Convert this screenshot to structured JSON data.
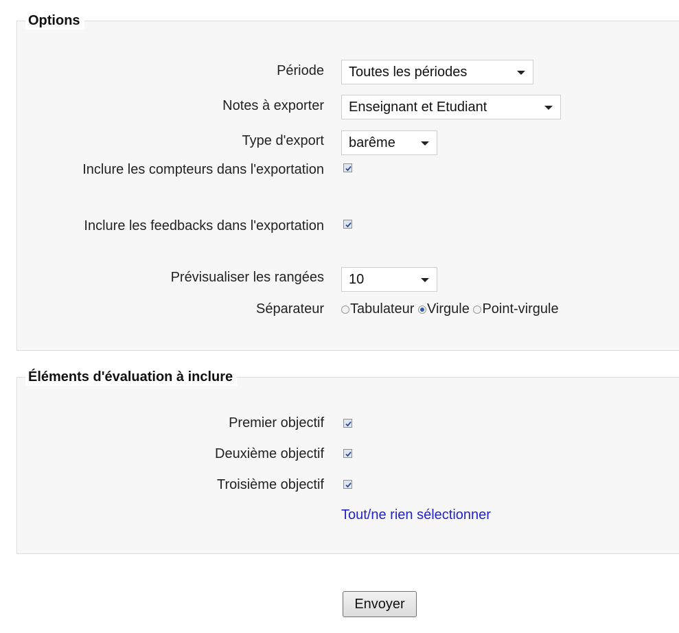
{
  "options": {
    "legend": "Options",
    "periode": {
      "label": "Période",
      "value": "Toutes les périodes"
    },
    "notes": {
      "label": "Notes à exporter",
      "value": "Enseignant et Etudiant"
    },
    "type": {
      "label": "Type d'export",
      "value": "barême"
    },
    "compteurs": {
      "label": "Inclure les compteurs dans l'exportation",
      "checked": true
    },
    "feedbacks": {
      "label": "Inclure les feedbacks dans l'exportation",
      "checked": true
    },
    "rangees": {
      "label": "Prévisualiser les rangées",
      "value": "10"
    },
    "separateur": {
      "label": "Séparateur",
      "options": [
        "Tabulateur",
        "Virgule",
        "Point-virgule"
      ],
      "selected": "Virgule"
    }
  },
  "eval": {
    "legend": "Éléments d'évaluation à inclure",
    "items": [
      {
        "label": "Premier objectif",
        "checked": true
      },
      {
        "label": "Deuxième objectif",
        "checked": true
      },
      {
        "label": "Troisième objectif",
        "checked": true
      }
    ],
    "select_all": "Tout/ne rien sélectionner"
  },
  "submit": "Envoyer"
}
